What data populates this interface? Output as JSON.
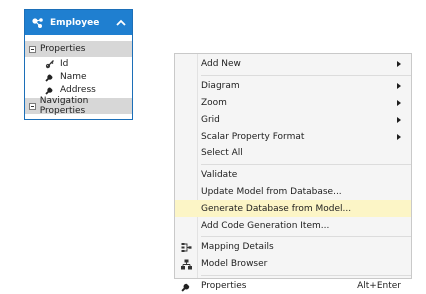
{
  "entity": {
    "title": "Employee",
    "properties_header": "Properties",
    "properties": [
      "Id",
      "Name",
      "Address"
    ],
    "navigation_header": "Navigation Properties",
    "header_color": "#1f7fd0"
  },
  "menu": {
    "highlight_color": "#fcf5c6",
    "groups": [
      [
        {
          "label": "Add New",
          "submenu": true
        }
      ],
      [
        {
          "label": "Diagram",
          "submenu": true
        },
        {
          "label": "Zoom",
          "submenu": true
        },
        {
          "label": "Grid",
          "submenu": true
        },
        {
          "label": "Scalar Property Format",
          "submenu": true
        },
        {
          "label": "Select All"
        }
      ],
      [
        {
          "label": "Validate"
        },
        {
          "label": "Update Model from Database..."
        },
        {
          "label": "Generate Database from Model...",
          "highlighted": true
        },
        {
          "label": "Add Code Generation Item..."
        }
      ],
      [
        {
          "label": "Mapping Details",
          "icon": "mapping-details-icon"
        },
        {
          "label": "Model Browser",
          "icon": "model-browser-icon"
        }
      ],
      [
        {
          "label": "Properties",
          "icon": "wrench-icon",
          "shortcut": "Alt+Enter"
        }
      ]
    ]
  }
}
